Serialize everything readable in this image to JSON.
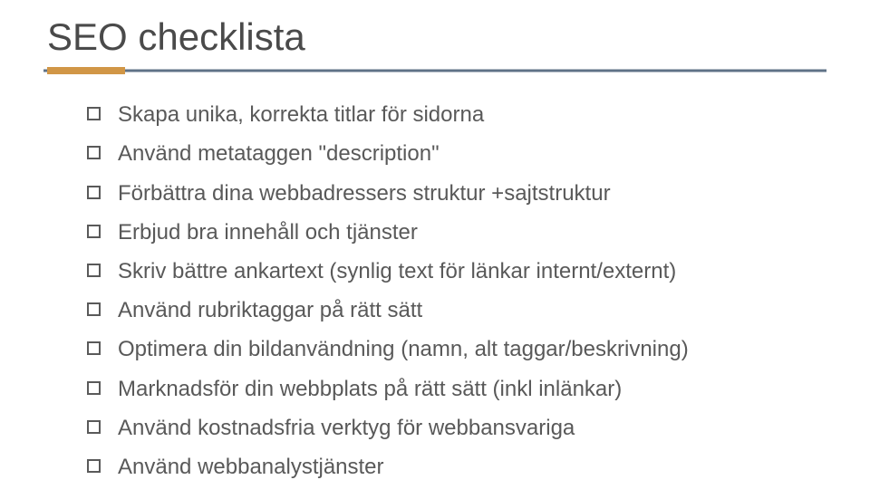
{
  "title": "SEO checklista",
  "accent_color": "#d19646",
  "rule_color": "#5f7287",
  "items": [
    "Skapa unika, korrekta titlar för sidorna",
    "Använd metataggen \"description\"",
    "Förbättra dina webbadressers struktur +sajtstruktur",
    "Erbjud bra innehåll och tjänster",
    "Skriv bättre ankartext (synlig text för länkar internt/externt)",
    "Använd rubriktaggar på rätt sätt",
    "Optimera din bildanvändning (namn, alt taggar/beskrivning)",
    "Marknadsför din webbplats på rätt sätt (inkl inlänkar)",
    "Använd kostnadsfria verktyg för webbansvariga",
    "Använd webbanalystjänster"
  ]
}
